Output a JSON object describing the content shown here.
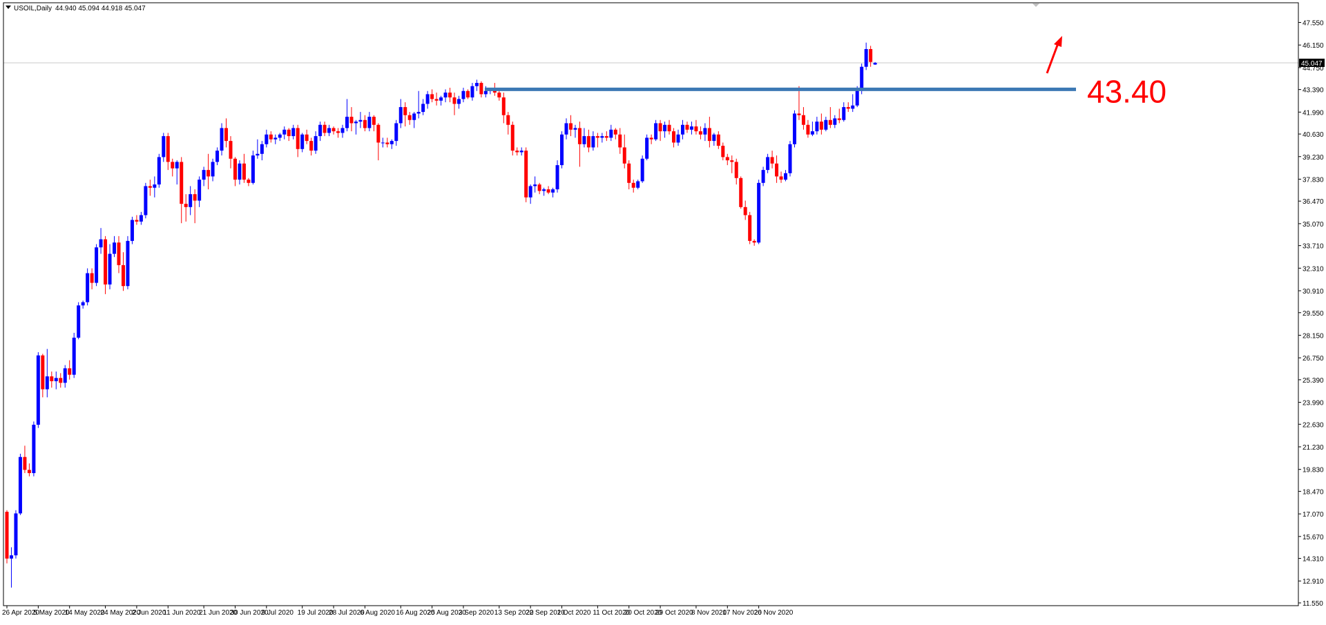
{
  "window": {
    "symbol_caption": "USOIL,Daily",
    "ohlc_caption": "44.940 45.094 44.918 45.047",
    "current_price_label": "45.047"
  },
  "colors": {
    "bull": "#0000ff",
    "bear": "#ff0000",
    "resistance": "#3c78b4",
    "annotation": "#ff0000",
    "axis": "#000000",
    "price_line": "#c8c8c8"
  },
  "chart_data": {
    "type": "candlestick",
    "symbol": "USOIL",
    "timeframe": "Daily",
    "ylim": [
      11.55,
      48.3
    ],
    "yticks": [
      47.55,
      46.15,
      44.75,
      43.39,
      41.99,
      40.63,
      39.23,
      37.83,
      36.47,
      35.07,
      33.71,
      32.31,
      30.91,
      29.55,
      28.15,
      26.75,
      25.39,
      23.99,
      22.63,
      21.23,
      19.83,
      18.47,
      17.07,
      15.67,
      14.31,
      12.91,
      11.55
    ],
    "ytick_labels": [
      "47.550",
      "46.150",
      "44.750",
      "43.390",
      "41.990",
      "40.630",
      "39.230",
      "37.830",
      "36.470",
      "35.070",
      "33.710",
      "32.310",
      "30.910",
      "29.550",
      "28.150",
      "26.750",
      "25.390",
      "23.990",
      "22.630",
      "21.230",
      "19.830",
      "18.470",
      "17.070",
      "15.670",
      "14.310",
      "12.910",
      "11.550"
    ],
    "xtick_labels": [
      "26 Apr 2020",
      "5 May 2020",
      "14 May 2020",
      "24 May 2020",
      "2 Jun 2020",
      "11 Jun 2020",
      "21 Jun 2020",
      "30 Jun 2020",
      "9 Jul 2020",
      "19 Jul 2020",
      "28 Jul 2020",
      "6 Aug 2020",
      "16 Aug 2020",
      "25 Aug 2020",
      "3 Sep 2020",
      "13 Sep 2020",
      "22 Sep 2020",
      "1 Oct 2020",
      "11 Oct 2020",
      "20 Oct 2020",
      "29 Oct 2020",
      "8 Nov 2020",
      "17 Nov 2020",
      "26 Nov 2020"
    ],
    "xtick_bar_index": [
      0,
      7,
      14,
      22,
      29,
      36,
      44,
      51,
      58,
      66,
      73,
      80,
      88,
      95,
      102,
      110,
      117,
      124,
      132,
      139,
      146,
      154,
      161,
      168
    ],
    "candles": [
      [
        17.2,
        17.3,
        14.0,
        14.3
      ],
      [
        14.3,
        15.0,
        12.5,
        14.5
      ],
      [
        14.5,
        17.3,
        14.3,
        17.1
      ],
      [
        17.1,
        20.8,
        17.0,
        20.6
      ],
      [
        20.6,
        21.3,
        19.6,
        19.8
      ],
      [
        19.8,
        20.2,
        19.4,
        19.6
      ],
      [
        19.6,
        22.8,
        19.4,
        22.6
      ],
      [
        22.6,
        27.1,
        22.4,
        26.9
      ],
      [
        26.9,
        27.0,
        24.3,
        24.8
      ],
      [
        24.8,
        27.3,
        24.3,
        25.6
      ],
      [
        25.6,
        25.9,
        24.9,
        25.3
      ],
      [
        25.3,
        25.9,
        24.8,
        25.5
      ],
      [
        25.5,
        25.8,
        24.9,
        25.2
      ],
      [
        25.2,
        26.3,
        24.9,
        26.1
      ],
      [
        26.1,
        26.6,
        25.4,
        25.7
      ],
      [
        25.7,
        28.3,
        25.5,
        28.0
      ],
      [
        28.0,
        30.2,
        27.9,
        30.0
      ],
      [
        30.0,
        30.3,
        29.8,
        30.2
      ],
      [
        30.2,
        32.3,
        30.0,
        32.0
      ],
      [
        32.0,
        32.3,
        31.0,
        31.4
      ],
      [
        31.4,
        33.8,
        31.2,
        33.6
      ],
      [
        33.6,
        34.8,
        33.2,
        34.1
      ],
      [
        34.1,
        34.3,
        30.7,
        31.3
      ],
      [
        31.3,
        33.8,
        31.0,
        33.2
      ],
      [
        33.2,
        34.3,
        33.0,
        33.9
      ],
      [
        33.9,
        34.3,
        32.0,
        32.5
      ],
      [
        32.5,
        33.3,
        30.9,
        31.2
      ],
      [
        31.2,
        34.3,
        31.0,
        34.0
      ],
      [
        34.0,
        35.5,
        33.8,
        35.3
      ],
      [
        35.3,
        35.6,
        35.0,
        35.2
      ],
      [
        35.2,
        35.8,
        35.0,
        35.6
      ],
      [
        35.6,
        37.6,
        35.4,
        37.4
      ],
      [
        37.4,
        37.8,
        36.8,
        37.3
      ],
      [
        37.3,
        38.0,
        36.7,
        37.5
      ],
      [
        37.5,
        39.4,
        37.3,
        39.2
      ],
      [
        39.2,
        40.7,
        38.9,
        40.5
      ],
      [
        40.5,
        40.7,
        38.4,
        38.9
      ],
      [
        38.9,
        39.1,
        38.0,
        38.5
      ],
      [
        38.5,
        39.0,
        37.5,
        38.9
      ],
      [
        38.9,
        39.2,
        35.1,
        36.3
      ],
      [
        36.3,
        36.9,
        35.2,
        36.1
      ],
      [
        36.1,
        37.4,
        35.6,
        36.9
      ],
      [
        36.9,
        37.2,
        35.1,
        36.5
      ],
      [
        36.5,
        38.0,
        36.1,
        37.8
      ],
      [
        37.8,
        38.6,
        37.4,
        38.4
      ],
      [
        38.4,
        39.4,
        37.2,
        38.0
      ],
      [
        38.0,
        39.1,
        37.7,
        38.9
      ],
      [
        38.9,
        39.8,
        38.7,
        39.6
      ],
      [
        39.6,
        41.3,
        39.3,
        41.0
      ],
      [
        41.0,
        41.6,
        39.8,
        40.2
      ],
      [
        40.2,
        40.5,
        38.5,
        39.1
      ],
      [
        39.1,
        39.2,
        37.4,
        37.8
      ],
      [
        37.8,
        39.0,
        37.5,
        38.8
      ],
      [
        38.8,
        39.4,
        37.6,
        37.8
      ],
      [
        37.8,
        37.9,
        37.4,
        37.6
      ],
      [
        37.6,
        39.6,
        37.5,
        39.3
      ],
      [
        39.3,
        40.3,
        39.1,
        39.4
      ],
      [
        39.4,
        40.2,
        39.0,
        40.0
      ],
      [
        40.0,
        40.9,
        39.8,
        40.6
      ],
      [
        40.6,
        40.8,
        40.1,
        40.3
      ],
      [
        40.3,
        40.6,
        40.0,
        40.4
      ],
      [
        40.4,
        40.7,
        40.2,
        40.6
      ],
      [
        40.6,
        41.1,
        40.3,
        40.9
      ],
      [
        40.9,
        41.0,
        40.2,
        40.5
      ],
      [
        40.5,
        41.2,
        40.3,
        41.0
      ],
      [
        41.0,
        41.2,
        39.2,
        39.7
      ],
      [
        39.7,
        40.7,
        39.5,
        40.6
      ],
      [
        40.6,
        40.9,
        40.0,
        40.2
      ],
      [
        40.2,
        40.4,
        39.3,
        39.6
      ],
      [
        39.6,
        40.8,
        39.4,
        40.5
      ],
      [
        40.5,
        41.4,
        40.2,
        41.2
      ],
      [
        41.2,
        41.4,
        40.5,
        40.7
      ],
      [
        40.7,
        41.2,
        40.5,
        41.0
      ],
      [
        41.0,
        41.1,
        40.6,
        40.8
      ],
      [
        40.8,
        41.0,
        40.4,
        40.7
      ],
      [
        40.7,
        41.2,
        40.4,
        41.0
      ],
      [
        41.0,
        42.8,
        40.8,
        41.7
      ],
      [
        41.7,
        42.3,
        40.8,
        41.3
      ],
      [
        41.3,
        41.5,
        40.6,
        41.4
      ],
      [
        41.4,
        42.0,
        41.0,
        41.5
      ],
      [
        41.5,
        41.8,
        40.8,
        41.0
      ],
      [
        41.0,
        42.0,
        40.8,
        41.7
      ],
      [
        41.7,
        41.8,
        40.8,
        41.2
      ],
      [
        41.2,
        41.3,
        39.0,
        40.1
      ],
      [
        40.1,
        40.4,
        39.8,
        40.1
      ],
      [
        40.1,
        40.4,
        39.8,
        40.0
      ],
      [
        40.0,
        40.3,
        39.7,
        40.2
      ],
      [
        40.2,
        41.5,
        39.9,
        41.3
      ],
      [
        41.3,
        42.8,
        41.0,
        42.3
      ],
      [
        42.3,
        42.6,
        41.1,
        41.8
      ],
      [
        41.8,
        42.0,
        41.2,
        41.5
      ],
      [
        41.5,
        42.0,
        41.0,
        41.9
      ],
      [
        41.9,
        43.3,
        41.6,
        42.0
      ],
      [
        42.0,
        42.8,
        41.8,
        42.5
      ],
      [
        42.5,
        43.3,
        42.2,
        43.1
      ],
      [
        43.1,
        43.4,
        42.6,
        42.8
      ],
      [
        42.8,
        43.2,
        42.4,
        42.7
      ],
      [
        42.7,
        43.0,
        42.4,
        42.9
      ],
      [
        42.9,
        43.4,
        42.6,
        43.2
      ],
      [
        43.2,
        43.5,
        42.6,
        42.9
      ],
      [
        42.9,
        43.2,
        41.8,
        42.5
      ],
      [
        42.5,
        43.0,
        42.2,
        42.8
      ],
      [
        42.8,
        43.5,
        42.6,
        43.3
      ],
      [
        43.3,
        43.4,
        42.8,
        42.9
      ],
      [
        42.9,
        43.8,
        42.7,
        43.6
      ],
      [
        43.6,
        44.0,
        43.3,
        43.8
      ],
      [
        43.8,
        43.9,
        42.9,
        43.1
      ],
      [
        43.1,
        43.6,
        42.9,
        43.3
      ],
      [
        43.3,
        43.5,
        43.1,
        43.4
      ],
      [
        43.4,
        43.8,
        43.0,
        43.2
      ],
      [
        43.2,
        43.5,
        42.7,
        42.9
      ],
      [
        42.9,
        43.2,
        41.3,
        41.8
      ],
      [
        41.8,
        42.0,
        40.6,
        41.2
      ],
      [
        41.2,
        41.4,
        39.3,
        39.6
      ],
      [
        39.6,
        39.8,
        39.3,
        39.5
      ],
      [
        39.5,
        39.8,
        39.3,
        39.6
      ],
      [
        39.6,
        39.8,
        36.4,
        36.7
      ],
      [
        36.7,
        37.5,
        36.3,
        37.4
      ],
      [
        37.4,
        38.0,
        37.0,
        37.5
      ],
      [
        37.5,
        37.6,
        36.9,
        37.1
      ],
      [
        37.1,
        37.3,
        36.8,
        37.2
      ],
      [
        37.2,
        37.4,
        36.9,
        37.0
      ],
      [
        37.0,
        37.3,
        36.7,
        37.2
      ],
      [
        37.2,
        39.0,
        37.0,
        38.7
      ],
      [
        38.7,
        40.8,
        38.5,
        40.6
      ],
      [
        40.6,
        41.6,
        40.3,
        41.3
      ],
      [
        41.3,
        41.8,
        40.5,
        40.9
      ],
      [
        40.9,
        41.2,
        40.4,
        41.0
      ],
      [
        41.0,
        41.4,
        38.6,
        40.0
      ],
      [
        40.0,
        41.0,
        39.8,
        40.5
      ],
      [
        40.5,
        40.9,
        39.5,
        39.8
      ],
      [
        39.8,
        40.8,
        39.6,
        40.5
      ],
      [
        40.5,
        40.7,
        39.8,
        40.4
      ],
      [
        40.4,
        40.7,
        40.1,
        40.5
      ],
      [
        40.5,
        40.8,
        40.2,
        40.4
      ],
      [
        40.4,
        41.2,
        40.2,
        40.9
      ],
      [
        40.9,
        41.0,
        40.3,
        40.6
      ],
      [
        40.6,
        41.0,
        39.4,
        39.8
      ],
      [
        39.8,
        40.6,
        38.5,
        38.8
      ],
      [
        38.8,
        39.0,
        37.2,
        37.6
      ],
      [
        37.6,
        37.8,
        37.0,
        37.3
      ],
      [
        37.3,
        37.8,
        37.2,
        37.7
      ],
      [
        37.7,
        39.3,
        37.6,
        39.1
      ],
      [
        39.1,
        40.6,
        39.0,
        40.4
      ],
      [
        40.4,
        40.6,
        40.0,
        40.3
      ],
      [
        40.3,
        41.5,
        40.2,
        41.3
      ],
      [
        41.3,
        41.5,
        40.2,
        40.8
      ],
      [
        40.8,
        41.4,
        40.4,
        41.2
      ],
      [
        41.2,
        41.5,
        40.6,
        40.8
      ],
      [
        40.8,
        41.0,
        39.8,
        40.1
      ],
      [
        40.1,
        40.9,
        39.9,
        40.6
      ],
      [
        40.6,
        41.5,
        40.3,
        41.2
      ],
      [
        41.2,
        41.4,
        40.7,
        40.9
      ],
      [
        40.9,
        41.4,
        40.6,
        41.1
      ],
      [
        41.1,
        41.5,
        40.6,
        40.8
      ],
      [
        40.8,
        41.1,
        40.3,
        40.6
      ],
      [
        40.6,
        41.3,
        40.2,
        41.0
      ],
      [
        41.0,
        41.7,
        39.8,
        40.2
      ],
      [
        40.2,
        40.7,
        39.9,
        40.6
      ],
      [
        40.6,
        40.8,
        39.7,
        39.9
      ],
      [
        39.9,
        40.1,
        39.0,
        39.2
      ],
      [
        39.2,
        39.4,
        38.7,
        39.0
      ],
      [
        39.0,
        39.3,
        38.2,
        38.9
      ],
      [
        38.9,
        39.1,
        37.5,
        37.9
      ],
      [
        37.9,
        38.0,
        36.0,
        36.1
      ],
      [
        36.1,
        36.5,
        35.3,
        35.6
      ],
      [
        35.6,
        35.8,
        33.8,
        34.0
      ],
      [
        34.0,
        34.1,
        33.7,
        33.9
      ],
      [
        33.9,
        37.8,
        33.8,
        37.6
      ],
      [
        37.6,
        38.6,
        37.4,
        38.4
      ],
      [
        38.4,
        39.4,
        38.2,
        39.2
      ],
      [
        39.2,
        39.6,
        38.5,
        38.8
      ],
      [
        38.8,
        39.3,
        37.6,
        38.0
      ],
      [
        38.0,
        38.3,
        37.6,
        37.8
      ],
      [
        37.8,
        38.4,
        37.7,
        38.2
      ],
      [
        38.2,
        40.2,
        38.0,
        40.0
      ],
      [
        40.0,
        42.1,
        39.8,
        41.9
      ],
      [
        41.9,
        43.6,
        41.5,
        41.8
      ],
      [
        41.8,
        42.3,
        40.9,
        41.2
      ],
      [
        41.2,
        41.5,
        40.4,
        40.6
      ],
      [
        40.6,
        41.4,
        40.5,
        40.8
      ],
      [
        40.8,
        41.7,
        40.6,
        41.4
      ],
      [
        41.4,
        41.9,
        40.6,
        40.9
      ],
      [
        40.9,
        41.7,
        40.8,
        41.5
      ],
      [
        41.5,
        42.3,
        41.0,
        41.2
      ],
      [
        41.2,
        41.8,
        41.0,
        41.6
      ],
      [
        41.6,
        42.2,
        41.3,
        41.5
      ],
      [
        41.5,
        42.6,
        41.4,
        42.3
      ],
      [
        42.3,
        42.6,
        42.0,
        42.2
      ],
      [
        42.2,
        43.1,
        42.0,
        42.4
      ],
      [
        42.4,
        43.6,
        42.3,
        43.3
      ],
      [
        43.3,
        45.0,
        43.1,
        44.8
      ],
      [
        44.8,
        46.3,
        44.6,
        45.9
      ],
      [
        45.9,
        46.1,
        44.8,
        45.1
      ],
      [
        44.94,
        45.094,
        44.918,
        45.047
      ]
    ],
    "resistance_level": 43.4,
    "resistance_label": "43.40"
  }
}
